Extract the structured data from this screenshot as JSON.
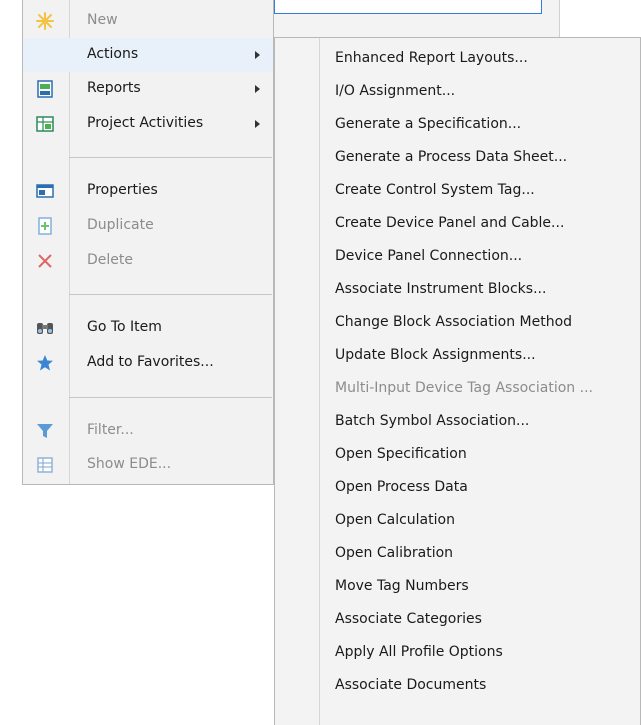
{
  "main_menu": {
    "items": [
      {
        "label": "New",
        "disabled": true,
        "icon": "new-star-icon",
        "submenu": false
      },
      {
        "label": "Actions",
        "disabled": false,
        "icon": "",
        "submenu": true,
        "highlighted": true
      },
      {
        "label": "Reports",
        "disabled": false,
        "icon": "reports-icon",
        "submenu": true
      },
      {
        "label": "Project Activities",
        "disabled": false,
        "icon": "project-activities-icon",
        "submenu": true
      },
      {
        "label": "Properties",
        "disabled": false,
        "icon": "properties-icon",
        "submenu": false
      },
      {
        "label": "Duplicate",
        "disabled": true,
        "icon": "duplicate-icon",
        "submenu": false
      },
      {
        "label": "Delete",
        "disabled": true,
        "icon": "delete-x-icon",
        "submenu": false
      },
      {
        "label": "Go To Item",
        "disabled": false,
        "icon": "binoculars-icon",
        "submenu": false
      },
      {
        "label": "Add to Favorites...",
        "disabled": false,
        "icon": "favorites-star-icon",
        "submenu": false
      },
      {
        "label": "Filter...",
        "disabled": true,
        "icon": "filter-funnel-icon",
        "submenu": false
      },
      {
        "label": "Show EDE...",
        "disabled": true,
        "icon": "show-ede-icon",
        "submenu": false
      }
    ]
  },
  "actions_submenu": {
    "items": [
      {
        "label": "Enhanced Report Layouts...",
        "disabled": false
      },
      {
        "label": "I/O Assignment...",
        "disabled": false
      },
      {
        "label": "Generate a Specification...",
        "disabled": false
      },
      {
        "label": "Generate a Process Data Sheet...",
        "disabled": false
      },
      {
        "label": "Create Control System Tag...",
        "disabled": false
      },
      {
        "label": "Create Device Panel and Cable...",
        "disabled": false
      },
      {
        "label": "Device Panel Connection...",
        "disabled": false
      },
      {
        "label": "Associate Instrument Blocks...",
        "disabled": false
      },
      {
        "label": "Change Block Association Method",
        "disabled": false
      },
      {
        "label": "Update Block Assignments...",
        "disabled": false
      },
      {
        "label": "Multi-Input Device Tag Association ...",
        "disabled": true
      },
      {
        "label": "Batch Symbol Association...",
        "disabled": false
      },
      {
        "label": "Open Specification",
        "disabled": false
      },
      {
        "label": "Open Process Data",
        "disabled": false
      },
      {
        "label": "Open Calculation",
        "disabled": false
      },
      {
        "label": "Open Calibration",
        "disabled": false
      },
      {
        "label": "Move Tag Numbers",
        "disabled": false
      },
      {
        "label": "Associate Categories",
        "disabled": false
      },
      {
        "label": "Apply All Profile Options",
        "disabled": false
      },
      {
        "label": "Associate Documents",
        "disabled": false
      }
    ]
  },
  "colors": {
    "highlight": "#e8f0fa",
    "disabled_text": "#8c8c8c",
    "accent_blue": "#3a7bd5"
  }
}
